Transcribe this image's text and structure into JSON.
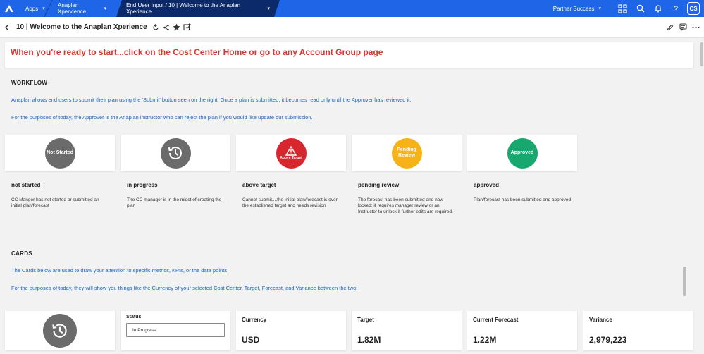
{
  "topbar": {
    "apps_label": "Apps",
    "model_label": "Anaplan Xpervience",
    "page_label": "End User Input / 10 | Welcome to the Anaplan Xperience",
    "workspace_label": "Partner Success",
    "avatar_initials": "CS"
  },
  "page": {
    "title": "10 | Welcome to the Anaplan Xperience"
  },
  "hero": {
    "text": "When you're ready to start...click on the Cost Center Home or go to any Account Group page"
  },
  "workflow": {
    "heading": "WORKFLOW",
    "line1": "Anaplan allows end users to submit their plan using the 'Submit' button seen on the right. Once a plan is submitted, it becomes read only until the Approver has reviewed it.",
    "line2": "For the purposes of today, the Approver is the Anaplan instructor who can reject the plan if you would like update our submission."
  },
  "statuses": [
    {
      "icon_text": "Not Started",
      "title": "not started",
      "desc": "CC Manger has not started or submitted an initial plan/forecast",
      "color": "#6b6b6b"
    },
    {
      "icon_text": "",
      "title": "in progress",
      "desc": "The CC manager is in the midst of creating the plan",
      "color": "#6b6b6b"
    },
    {
      "icon_text": "Above Target",
      "title": "above target",
      "desc": "Cannot submit....the initial plan/forecast is over the established target and needs revision",
      "color": "#d7262e"
    },
    {
      "icon_text": "Pending Review",
      "title": "pending review",
      "desc": "The forecast has been submitted and now locked; it requires manager review or an Instructor to unlock if further edits are required.",
      "color": "#f6b217"
    },
    {
      "icon_text": "Approved",
      "title": "approved",
      "desc": "Plan/forecast has been submitted and approved",
      "color": "#18a76e"
    }
  ],
  "cards": {
    "heading": "CARDS",
    "line1": "The Cards below are used to draw your attention to specific metrics, KPIs, or the data points",
    "line2": "For the purposes of today, they will show you things like the Currency of your selected Cost Center, Target, Forecast, and Variance between the two."
  },
  "kpis": {
    "status_label": "Status",
    "status_value": "In Progress",
    "currency_label": "Currency",
    "currency_value": "USD",
    "target_label": "Target",
    "target_value": "1.82M",
    "forecast_label": "Current Forecast",
    "forecast_value": "1.22M",
    "variance_label": "Variance",
    "variance_value": "2,979,223"
  }
}
